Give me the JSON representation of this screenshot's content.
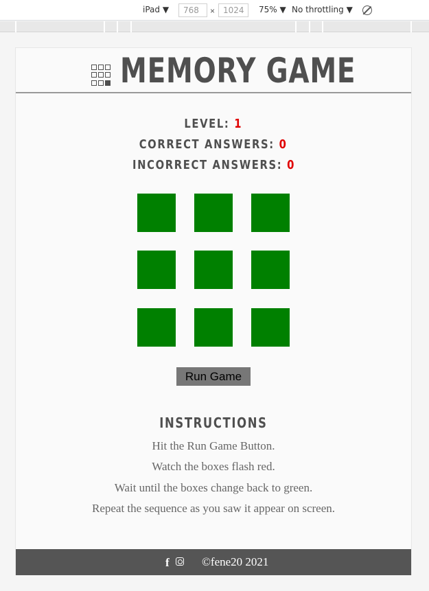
{
  "devtools": {
    "device": "iPad",
    "width": "768",
    "height": "1024",
    "times": "×",
    "zoom": "75%",
    "throttling": "No throttling",
    "caret": "▼"
  },
  "header": {
    "title": "MEMORY GAME"
  },
  "stats": {
    "level_label": "LEVEL:",
    "level_value": "1",
    "correct_label": "CORRECT ANSWERS:",
    "correct_value": "0",
    "incorrect_label": "INCORRECT ANSWERS:",
    "incorrect_value": "0"
  },
  "grid": {
    "box_color": "#008000"
  },
  "controls": {
    "run_label": "Run Game"
  },
  "instructions": {
    "title": "INSTRUCTIONS",
    "lines": [
      "Hit the Run Game Button.",
      "Watch the boxes flash red.",
      "Wait until the boxes change back to green.",
      "Repeat the sequence as you saw it appear on screen."
    ]
  },
  "footer": {
    "facebook_glyph": "f",
    "copyright": "©fene20 2021"
  },
  "colors": {
    "accent_red": "#e00000",
    "footer_bg": "#555555"
  }
}
